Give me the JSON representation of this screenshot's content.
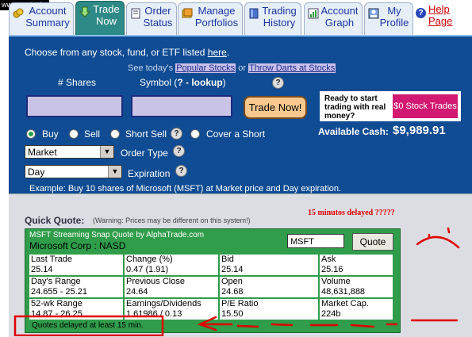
{
  "watermark": "www.zealsoft.com",
  "tabs": [
    {
      "id": "account-summary",
      "label": "Account\nSummary",
      "active": false
    },
    {
      "id": "trade-now",
      "label": "Trade\nNow",
      "active": true
    },
    {
      "id": "order-status",
      "label": "Order\nStatus",
      "active": false
    },
    {
      "id": "manage-portfolios",
      "label": "Manage\nPortfolios",
      "active": false
    },
    {
      "id": "trading-history",
      "label": "Trading\nHistory",
      "active": false
    },
    {
      "id": "account-graph",
      "label": "Account\nGraph",
      "active": false
    },
    {
      "id": "my-profile",
      "label": "My\nProfile",
      "active": false
    }
  ],
  "help": {
    "label": "Help\nPage"
  },
  "trade": {
    "intro_text": "Choose from any stock, fund, or ETF listed ",
    "intro_link": "here",
    "intro_end": ".",
    "see_today": "See today's",
    "popular_stocks": "Popular Stocks",
    "or": "or",
    "throw_darts": "Throw Darts at Stocks",
    "shares_label": "# Shares",
    "symbol_label": "Symbol (",
    "lookup_link": "? - lookup",
    "symbol_label_end": ")",
    "shares_value": "",
    "symbol_value": "",
    "submit_label": "Trade Now!",
    "radios": [
      {
        "label": "Buy",
        "checked": true
      },
      {
        "label": "Sell",
        "checked": false
      },
      {
        "label": "Short Sell",
        "checked": false
      },
      {
        "label": "Cover a Short",
        "checked": false
      }
    ],
    "order_type_value": "Market",
    "order_type_label": "Order Type",
    "expiration_value": "Day",
    "expiration_label": "Expiration",
    "example": "Example: Buy 10 shares of Microsoft (MSFT) at Market price and Day expiration.",
    "ad_text": "Ready to start trading with real money?",
    "ad_button": "$0 Stock Trades",
    "available_cash_label": "Available Cash:",
    "available_cash_value": "$9,989.91"
  },
  "quick_quote": {
    "title": "Quick Quote:",
    "warning": "(Warning: Prices may be different on this system!)",
    "header": "MSFT Streaming Snap Quote by AlphaTrade.com",
    "company": "Microsoft Corp : NASD",
    "symbol_value": "MSFT",
    "quote_button": "Quote",
    "cells": [
      {
        "label": "Last Trade",
        "value": "25.14"
      },
      {
        "label": "Change (%)",
        "value": "0.47 (1.91)"
      },
      {
        "label": "Bid",
        "value": "25.14"
      },
      {
        "label": "Ask",
        "value": "25.16"
      },
      {
        "label": "Day's Range",
        "value": "24.655 - 25.21"
      },
      {
        "label": "Previous Close",
        "value": "24.64"
      },
      {
        "label": "Open",
        "value": "24.68"
      },
      {
        "label": "Volume",
        "value": "48,631,888"
      },
      {
        "label": "52-wk Range",
        "value": "14.87 - 26.25"
      },
      {
        "label": "Earnings/Dividends",
        "value": "1.61986 / 0.13"
      },
      {
        "label": "P/E Ratio",
        "value": "15.50"
      },
      {
        "label": "Market Cap.",
        "value": "224b"
      }
    ],
    "footer": "Quotes delayed at least 15 min."
  },
  "annotation": {
    "text": "15  minutos delayed ?????",
    "color": "#dd0000"
  }
}
